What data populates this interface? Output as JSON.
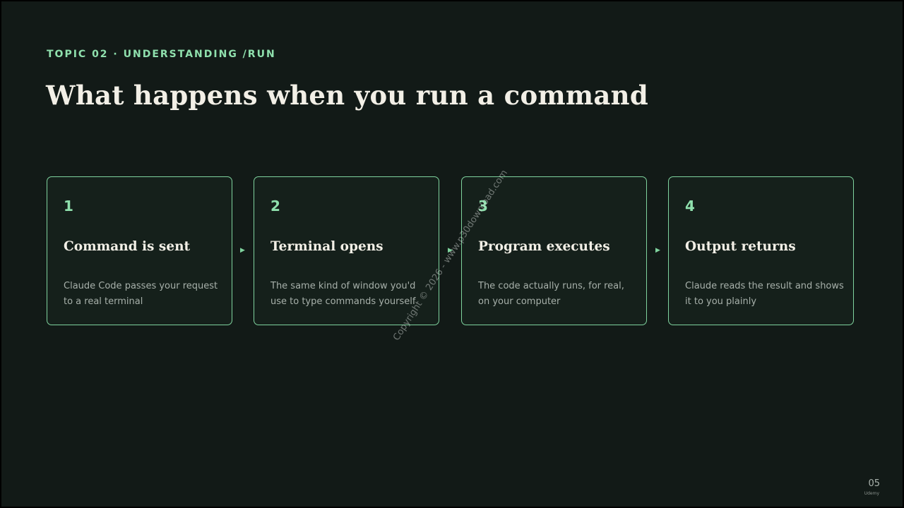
{
  "slide": {
    "eyebrow": "TOPIC 02 · UNDERSTANDING /RUN",
    "title": "What happens when you run a command",
    "page_number": "05",
    "brand": "Udemy",
    "watermark": "Copyright © 2026 - www.p30download.com"
  },
  "steps": [
    {
      "number": "1",
      "title": "Command is sent",
      "description": "Claude Code passes your request to a real terminal"
    },
    {
      "number": "2",
      "title": "Terminal opens",
      "description": "The same kind of window you'd use to type commands yourself"
    },
    {
      "number": "3",
      "title": "Program executes",
      "description": "The code actually runs, for real, on your computer"
    },
    {
      "number": "4",
      "title": "Output returns",
      "description": "Claude reads the result and shows it to you plainly"
    }
  ],
  "icons": {
    "arrow": "arrow-right-icon"
  },
  "colors": {
    "background": "#121a17",
    "accent": "#8fe0ad",
    "card_border": "#7fd39e",
    "title": "#f2efe6",
    "body_text": "#a7b0aa"
  }
}
